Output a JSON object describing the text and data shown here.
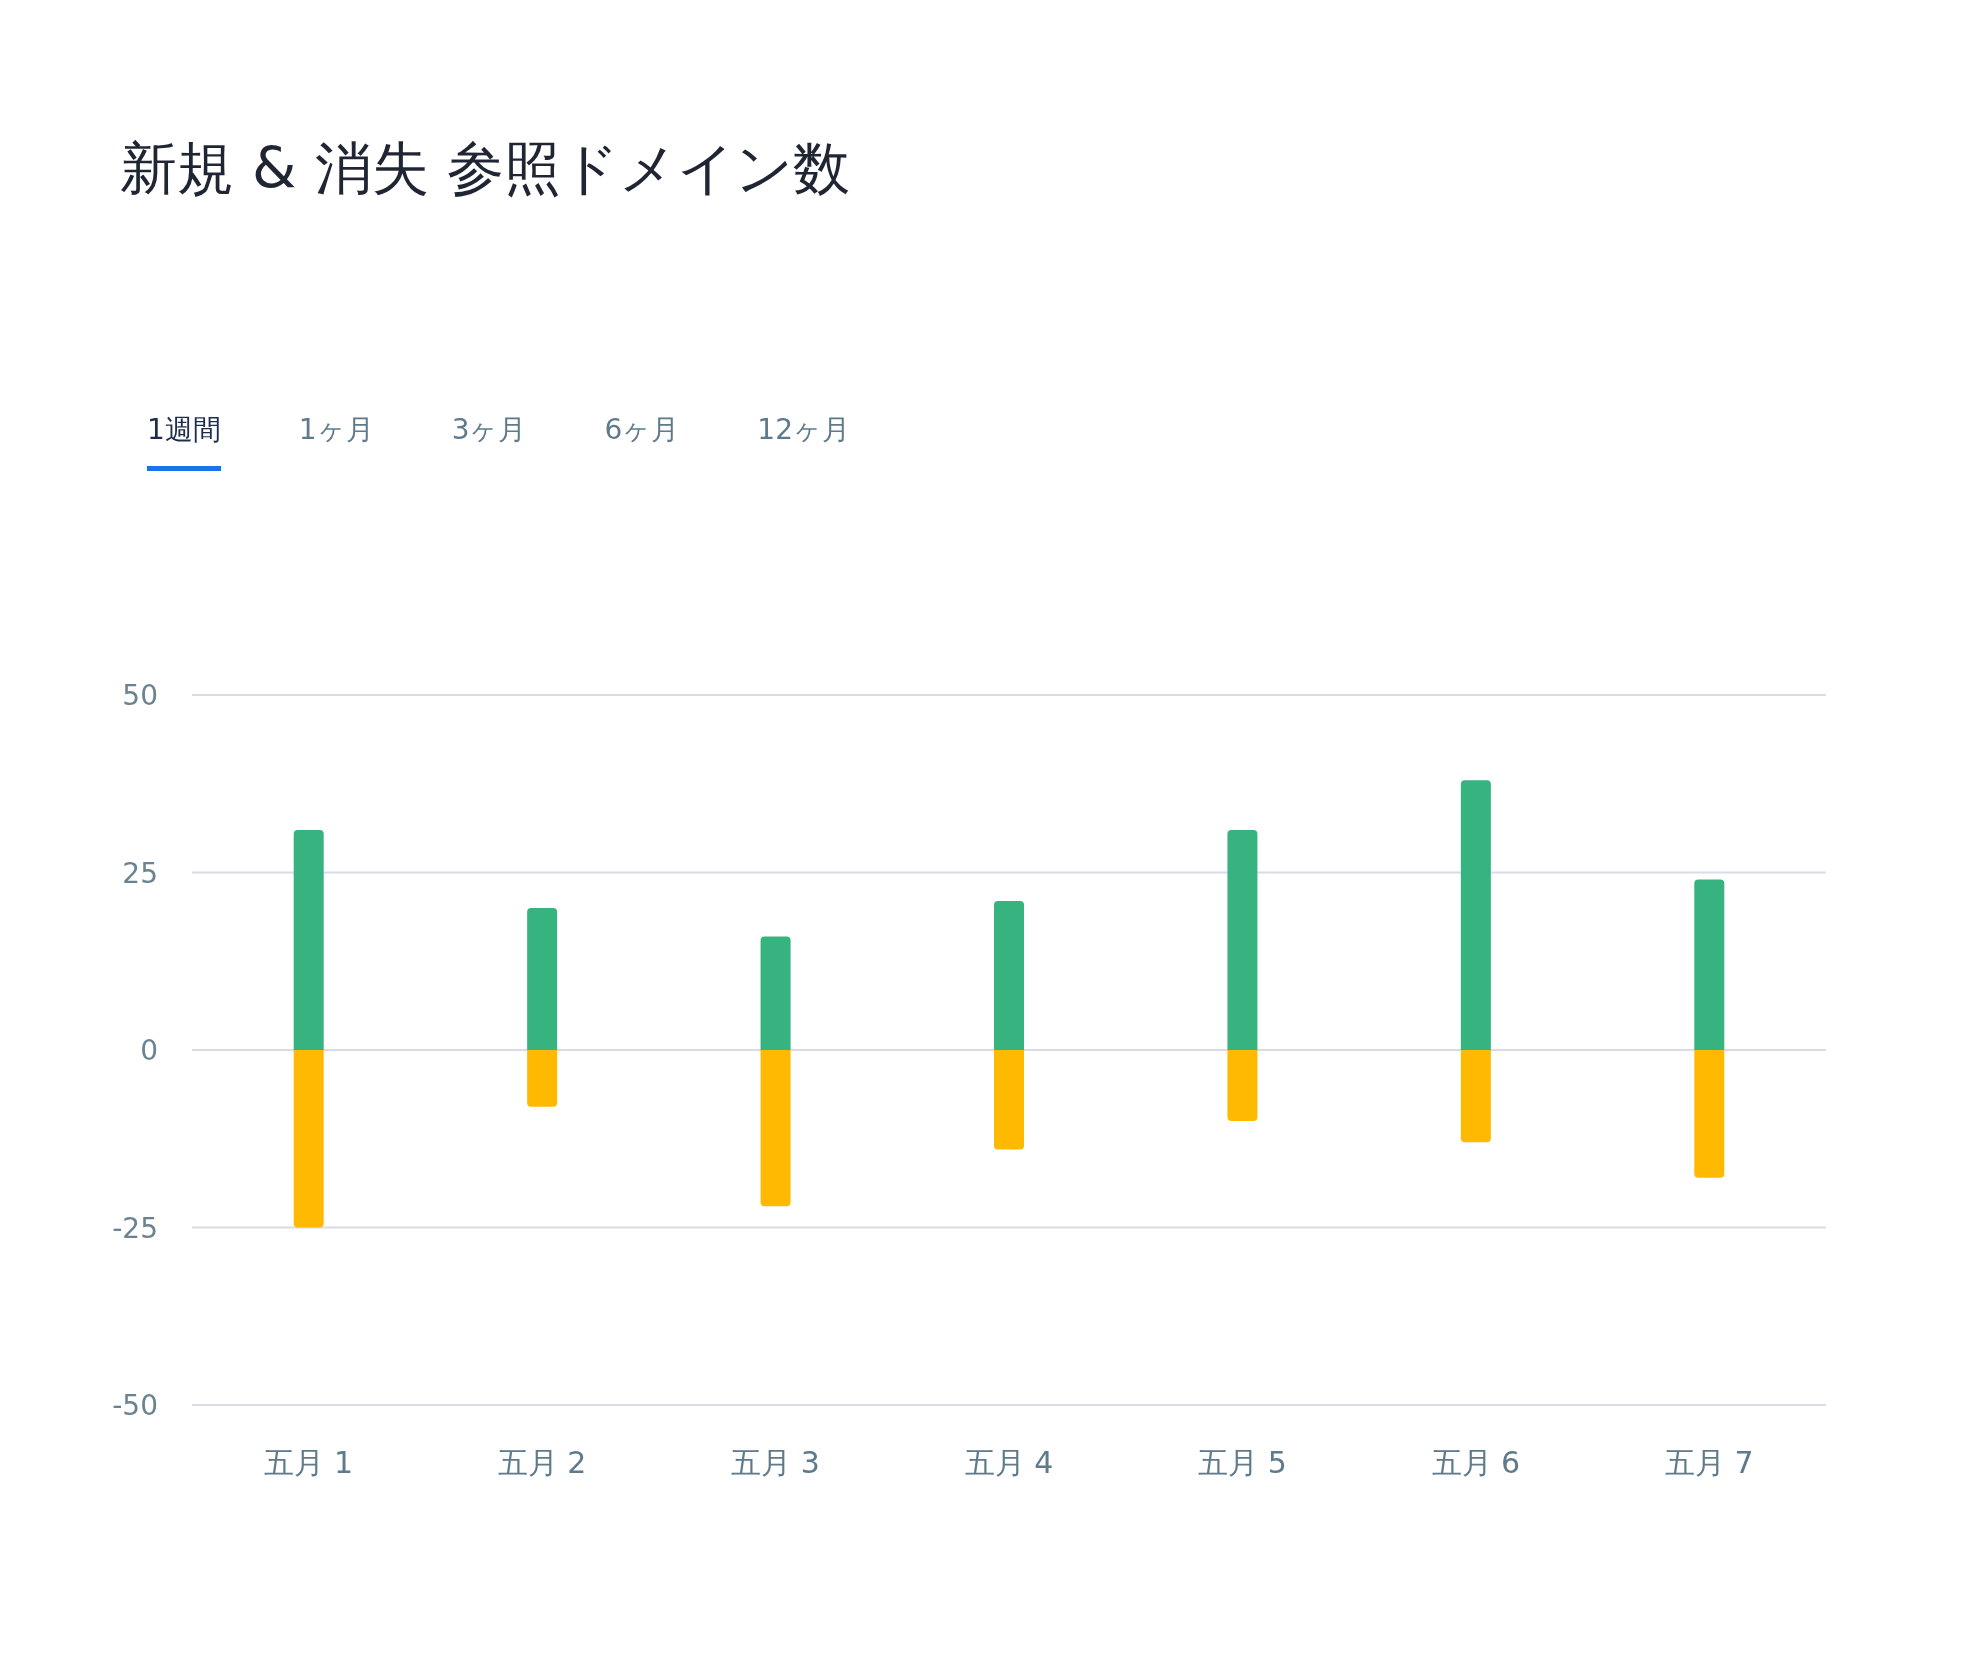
{
  "title": "新規 & 消失 参照ドメイン数",
  "tabs": [
    {
      "label": "1週間",
      "selected": true
    },
    {
      "label": "1ヶ月",
      "selected": false
    },
    {
      "label": "3ヶ月",
      "selected": false
    },
    {
      "label": "6ヶ月",
      "selected": false
    },
    {
      "label": "12ヶ月",
      "selected": false
    }
  ],
  "chart_data": {
    "type": "bar",
    "stacked": true,
    "grid": true,
    "categories": [
      "五月 1",
      "五月 2",
      "五月 3",
      "五月 4",
      "五月 5",
      "五月 6",
      "五月 7"
    ],
    "ylim": [
      -50,
      50
    ],
    "yticks": [
      -50,
      -25,
      0,
      25,
      50
    ],
    "series": [
      {
        "color": "#36b37e",
        "values": [
          31,
          20,
          16,
          21,
          31,
          38,
          24
        ]
      },
      {
        "color": "#ffb900",
        "values": [
          -25,
          -8,
          -22,
          -14,
          -10,
          -13,
          -18
        ]
      }
    ]
  }
}
